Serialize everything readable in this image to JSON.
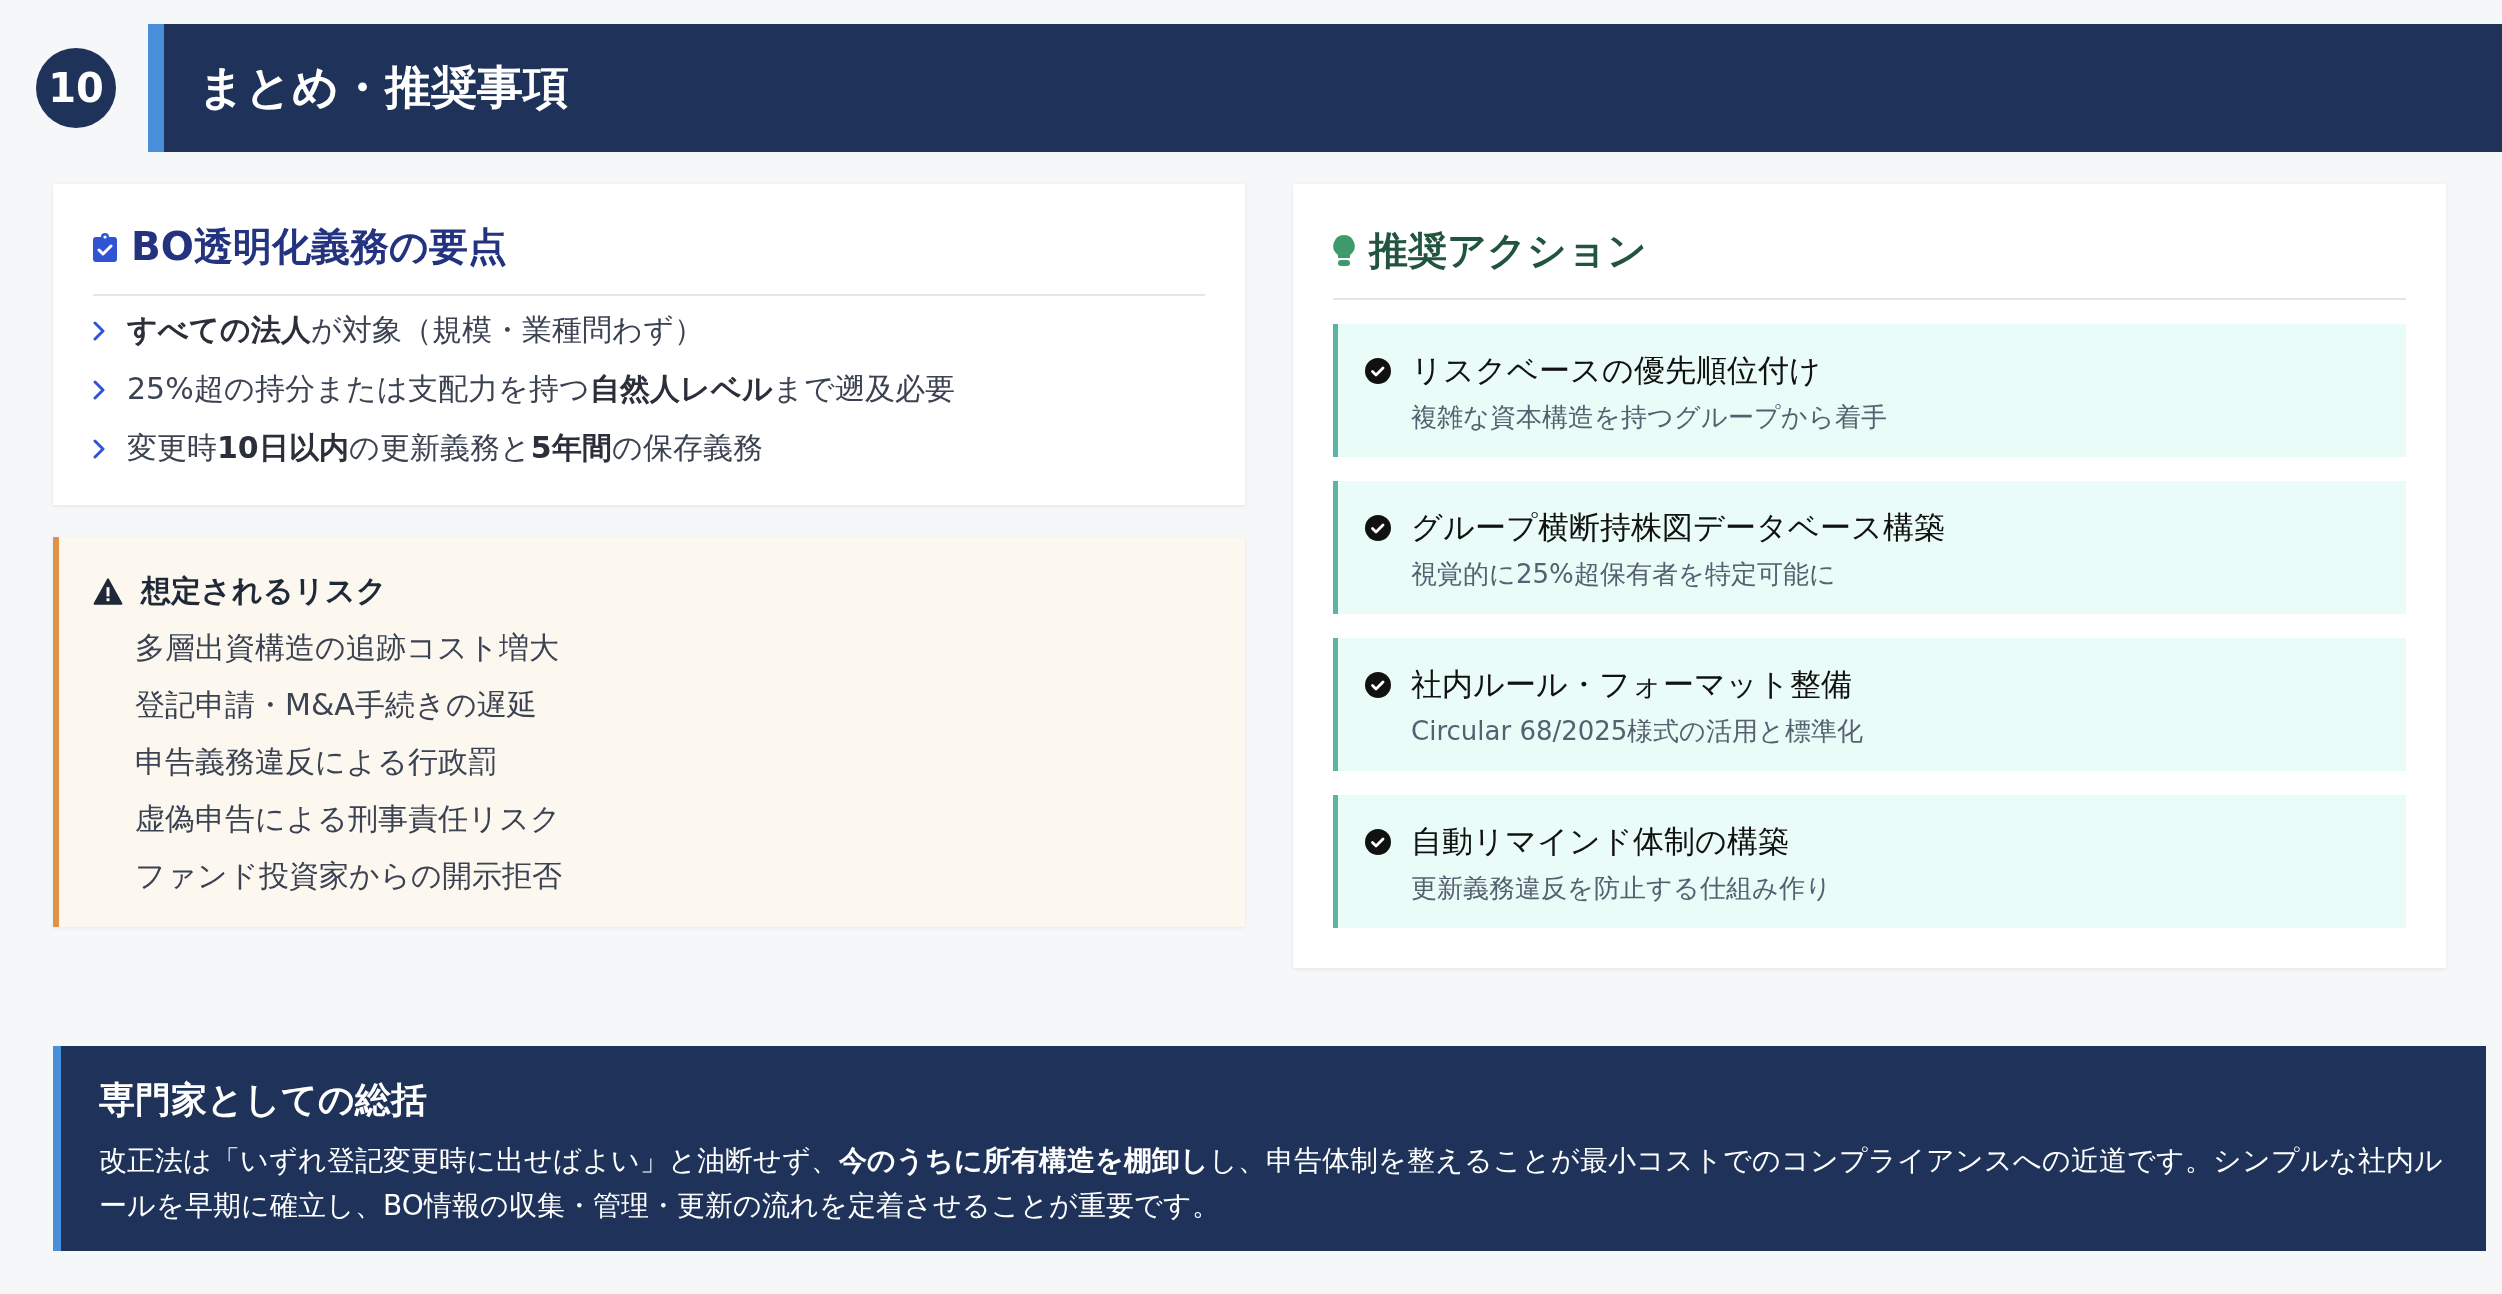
{
  "section": {
    "number": "10",
    "title": "まとめ・推奨事項"
  },
  "key_points": {
    "title": "BO透明化義務の要点",
    "items": [
      {
        "text": "**すべての法人**が対象（規模・業種問わず）"
      },
      {
        "text": "25%超の持分または支配力を持つ**自然人レベル**まで遡及必要"
      },
      {
        "text": "変更時**10日以内**の更新義務と**5年間**の保存義務"
      }
    ]
  },
  "risks": {
    "title": "想定されるリスク",
    "items": [
      "多層出資構造の追跡コスト増大",
      "登記申請・M&A手続きの遅延",
      "申告義務違反による行政罰",
      "虚偽申告による刑事責任リスク",
      "ファンド投資家からの開示拒否"
    ]
  },
  "actions": {
    "title": "推奨アクション",
    "items": [
      {
        "title": "リスクベースの優先順位付け",
        "detail": "複雑な資本構造を持つグループから着手"
      },
      {
        "title": "グループ横断持株図データベース構築",
        "detail": "視覚的に25%超保有者を特定可能に"
      },
      {
        "title": "社内ルール・フォーマット整備",
        "detail": "Circular 68/2025様式の活用と標準化"
      },
      {
        "title": "自動リマインド体制の構築",
        "detail": "更新義務違反を防止する仕組み作り"
      }
    ]
  },
  "summary": {
    "title": "専門家としての総括",
    "text": "改正法は「いずれ登記変更時に出せばよい」と油断せず、**今のうちに所有構造を棚卸し**し、申告体制を整えることが最小コストでのコンプライアンスへの近道です。シンプルな社内ルールを早期に確立し、BO情報の収集・管理・更新の流れを定着させることが重要です。"
  }
}
